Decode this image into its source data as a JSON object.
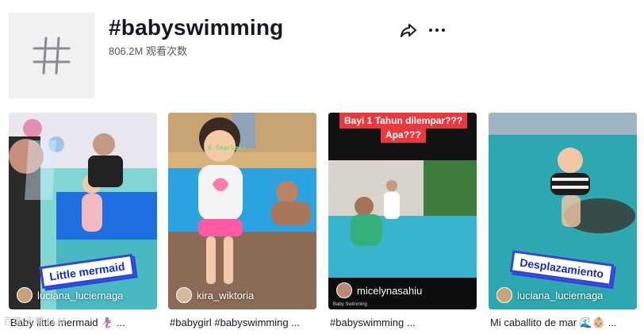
{
  "header": {
    "title": "#babyswimming",
    "views": "806.2M 观看次数"
  },
  "icons": {
    "hashtag": "hashtag-icon",
    "share": "share-icon",
    "more": "more-icon"
  },
  "videos": [
    {
      "author": "luciana_luciernaga",
      "caption": "Baby little mermaid 🧜🏽‍♀️ ...",
      "sticker": "Little mermaid"
    },
    {
      "author": "kira_wiktoria",
      "caption": "#babygirl #babyswimming ...",
      "overlay": "A fearless"
    },
    {
      "author": "micelynasahiu",
      "caption": "#babyswimming ...",
      "overlay_line1": "Bayi 1 Tahun dilempar???",
      "overlay_line2": "Apa???",
      "brand": "Baby Swimming"
    },
    {
      "author": "luciana_luciernaga",
      "caption": "Mi caballito de mar 🌊👶🏼 ...",
      "sticker": "Desplazamiento"
    }
  ],
  "watermark": "百度·天晴 LLM"
}
